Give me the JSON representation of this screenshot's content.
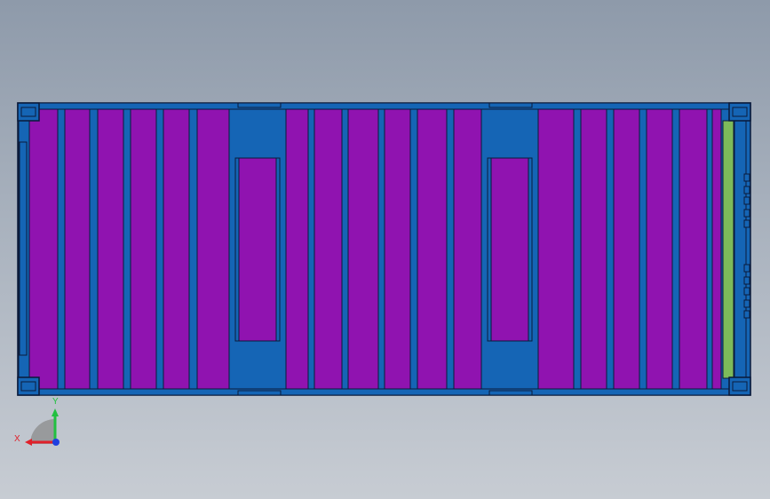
{
  "view": {
    "background_top": "#8e9aaa",
    "background_bottom": "#c7ccd3"
  },
  "model": {
    "frame_color": "#1565b5",
    "panel_color": "#9013b0",
    "outline_color": "#0a1a3a",
    "door_color": "#7dbb5a",
    "corner_castings": 4,
    "forklift_pockets": 2
  },
  "triad": {
    "x_label": "X",
    "y_label": "Y",
    "x_color": "#e0202a",
    "y_color": "#22c040",
    "z_color": "#2040e0"
  }
}
